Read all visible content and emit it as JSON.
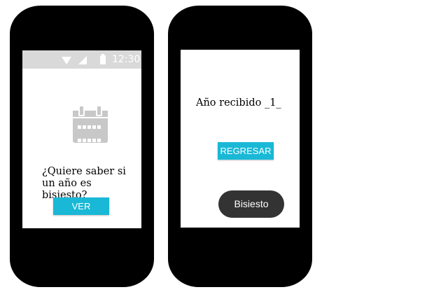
{
  "left_screen": {
    "status_bar": {
      "time": "12:30",
      "icons": [
        "wifi-icon",
        "signal-icon",
        "battery-icon"
      ]
    },
    "icon": "calendar-icon",
    "question": "¿Quiere saber si un año es bisiesto?",
    "button_label": "VER"
  },
  "right_screen": {
    "received_text": "Año recibido _1_",
    "button_label": "REGRESAR"
  },
  "toast": {
    "message": "Bisiesto"
  },
  "colors": {
    "accent": "#19b8d6",
    "status_bar": "#d9d9d9",
    "icon_gray": "#c8c8c8",
    "toast_bg": "#333333",
    "device_frame": "#000000"
  }
}
